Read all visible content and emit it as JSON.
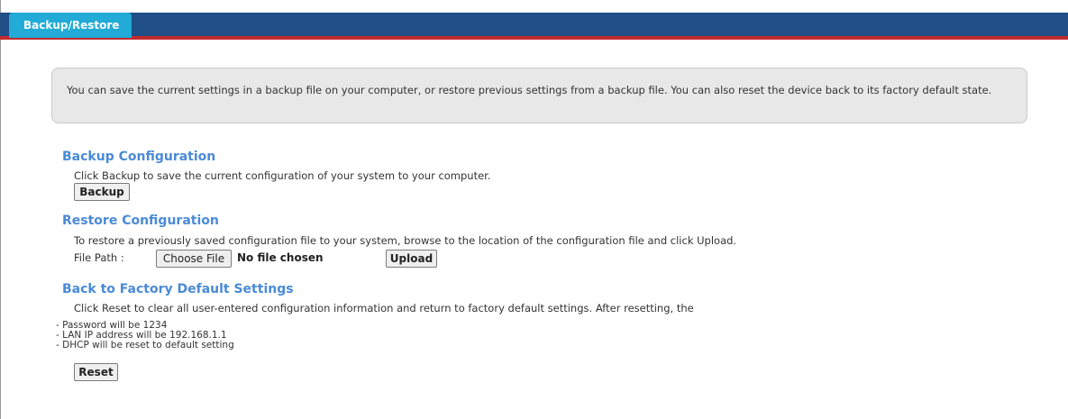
{
  "tab": {
    "label": "Backup/Restore"
  },
  "info": {
    "text": "You can save the current settings in a backup file on your computer, or restore previous settings from a backup file. You can also reset the device back to its factory default state."
  },
  "backup": {
    "title": "Backup Configuration",
    "description": "Click Backup to save the current configuration of your system to your computer.",
    "button_label": "Backup"
  },
  "restore": {
    "title": "Restore Configuration",
    "description": "To restore a previously saved configuration file to your system, browse to the location of the configuration file and click Upload.",
    "file_path_label": "File Path :",
    "choose_file_label": "Choose File",
    "no_file_text": "No file chosen",
    "upload_label": "Upload"
  },
  "factory": {
    "title": "Back to Factory Default Settings",
    "description": "Click Reset to clear all user-entered configuration information and return to factory default settings. After resetting, the",
    "notes": [
      "- Password will be 1234",
      "- LAN IP address will be 192.168.1.1",
      "- DHCP will be reset to default setting"
    ],
    "reset_label": "Reset"
  },
  "colors": {
    "header_bar": "#1f4f86",
    "header_rule": "#c22a2e",
    "tab": "#21abd6",
    "section_title": "#4a8ad6"
  }
}
